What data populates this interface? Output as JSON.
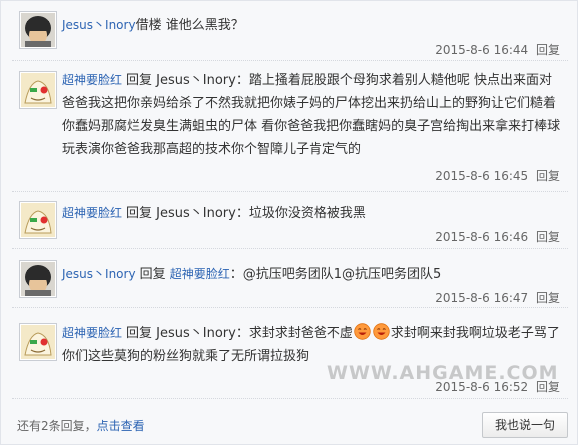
{
  "replies": [
    {
      "username": "Jesus丶Inory",
      "avatar": "dark-haired-face-avatar",
      "prefix": "",
      "mention": "",
      "text": "借楼 谁他么黑我？",
      "time": "2015-8-6 16:44",
      "reply_label": "回复"
    },
    {
      "username": "超神要脸红",
      "avatar": "cartoon-figure-avatar",
      "prefix": "回复 ",
      "mention": "Jesus丶Inory",
      "text": "：踏上搔着屁股跟个母狗求着别人糙他呢 快点出来面对爸爸我这把你亲妈给杀了不然我就把你婊子妈的尸体挖出来扔给山上的野狗让它们糙着你蠢妈那腐烂发臭生满蛆虫的尸体 看你爸爸我把你蠢瞎妈的臭子宫给掏出来拿来打棒球玩表演你爸爸我那高超的技术你个智障儿子肯定气的",
      "time": "2015-8-6 16:45",
      "reply_label": "回复"
    },
    {
      "username": "超神要脸红",
      "avatar": "cartoon-figure-avatar",
      "prefix": "回复 ",
      "mention": "Jesus丶Inory",
      "text": "：垃圾你没资格被我黑",
      "time": "2015-8-6 16:46",
      "reply_label": "回复"
    },
    {
      "username": "Jesus丶Inory",
      "avatar": "dark-haired-face-avatar",
      "prefix": "回复 ",
      "mention": "超神要脸红",
      "text": "：@抗压吧务团队1@抗压吧务团队5",
      "time": "2015-8-6 16:47",
      "reply_label": "回复"
    },
    {
      "username": "超神要脸红",
      "avatar": "cartoon-figure-avatar",
      "prefix": "回复 ",
      "mention": "Jesus丶Inory",
      "text_before_emoji": "：求封求封爸爸不虚",
      "text": "求封啊来封我啊垃圾老子骂了你们这些莫狗的粉丝狗就乘了无所谓拉扱狗",
      "time": "2015-8-6 16:52",
      "reply_label": "回复"
    }
  ],
  "footer": {
    "more_text": "还有2条回复，",
    "more_link": "点击查看",
    "say_button": "我也说一句"
  },
  "watermark": "WWW.AHGAME.COM",
  "colors": {
    "link": "#2d64b3",
    "background": "#f7f8fa",
    "border": "#e1e4ea"
  }
}
